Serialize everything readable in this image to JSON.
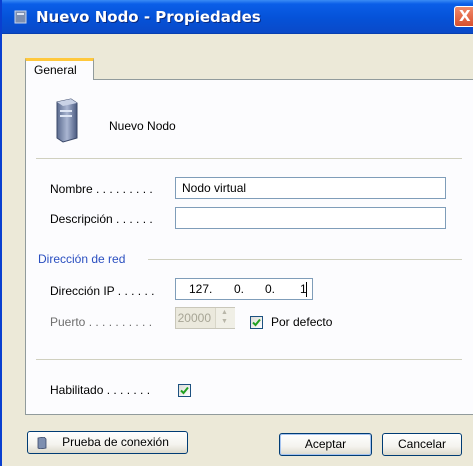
{
  "window": {
    "title": "Nuevo Nodo - Propiedades",
    "close_glyph": "X"
  },
  "tabs": [
    {
      "label": "General",
      "active": true
    }
  ],
  "node": {
    "icon": "server-node-icon",
    "name": "Nuevo Nodo"
  },
  "fields": {
    "nombre": {
      "label": "Nombre . . . . . . . . .",
      "value": "Nodo virtual"
    },
    "descripcion": {
      "label": "Descripción . . . . . .",
      "value": ""
    }
  },
  "network": {
    "section_title": "Dirección de red",
    "ip": {
      "label": "Dirección IP . . . . . .",
      "octets": [
        "127.",
        "0.",
        "0.",
        "1"
      ]
    },
    "port": {
      "label": "Puerto . . . . . . . . . .",
      "value": "20000",
      "enabled": false
    },
    "por_defecto": {
      "label": "Por defecto",
      "checked": true
    }
  },
  "habilitado": {
    "label": "Habilitado . . . . . . .",
    "checked": true
  },
  "buttons": {
    "test_connection": "Prueba de conexión",
    "accept": "Aceptar",
    "cancel": "Cancelar"
  },
  "colors": {
    "titlebar": "#0552d8",
    "section_title": "#2a4fc0",
    "check": "#21a121"
  }
}
